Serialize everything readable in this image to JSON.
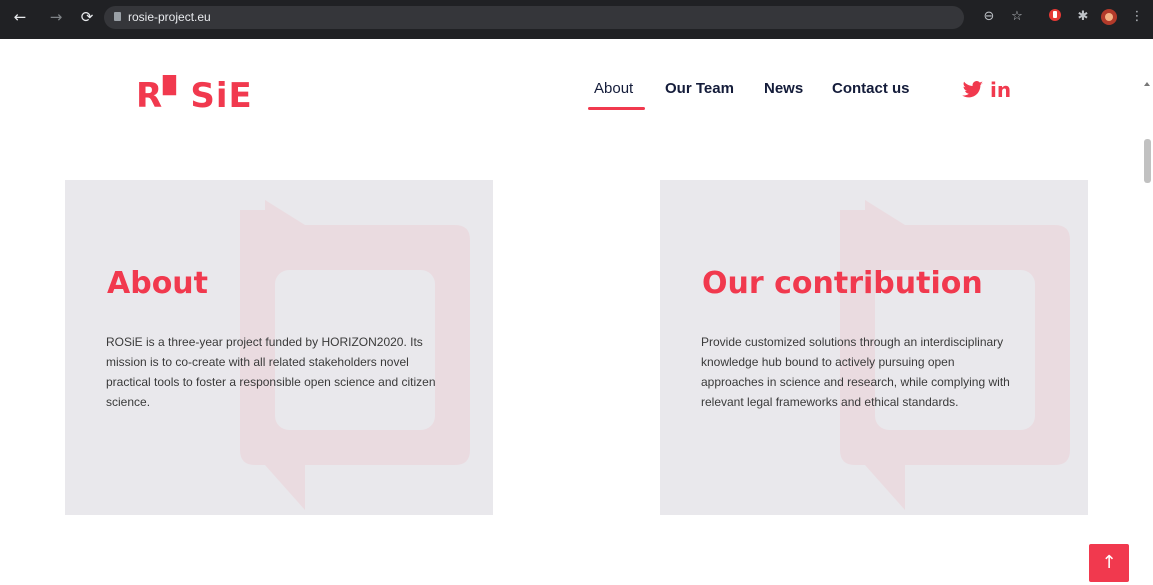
{
  "browser": {
    "url": "rosie-project.eu",
    "back_glyph": "←",
    "forward_glyph": "→",
    "reload_glyph": "⟳"
  },
  "site": {
    "logo_text": "R▘SiE",
    "accent_color": "#f1394e",
    "nav": [
      {
        "label": "About",
        "active": true
      },
      {
        "label": "Our Team",
        "active": false
      },
      {
        "label": "News",
        "active": false
      },
      {
        "label": "Contact us",
        "active": false
      }
    ],
    "social": [
      "twitter-icon",
      "linkedin-icon"
    ],
    "linkedin_glyph": "in"
  },
  "cards": [
    {
      "title": "About",
      "body": "ROSiE is a three-year project funded by HORIZON2020. Its mission is to co-create with all related stakeholders novel practical tools to foster a responsible open science and citizen science."
    },
    {
      "title": "Our contribution",
      "body": "Provide customized solutions through an interdisciplinary knowledge hub bound to actively pursuing open approaches in science and research, while complying with relevant legal frameworks and ethical standards."
    }
  ],
  "scroll_to_top_glyph": "↑"
}
